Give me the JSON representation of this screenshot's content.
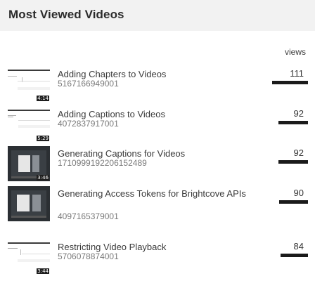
{
  "header": {
    "title": "Most Viewed Videos"
  },
  "columns": {
    "views_label": "views"
  },
  "colors": {
    "bar": "#1a1a1a",
    "header_bg": "#f2f2f2"
  },
  "videos": [
    {
      "name": "Adding Chapters to Videos",
      "id": "5167166949001",
      "duration": "4:14",
      "views": "111",
      "views_value": 111,
      "thumb": "wide-blank"
    },
    {
      "name": "Adding Captions to Videos",
      "id": "4072837917001",
      "duration": "5:29",
      "views": "92",
      "views_value": 92,
      "thumb": "wide-blank"
    },
    {
      "name": "Generating Captions for Videos",
      "id": "1710999192206152489",
      "duration": "3:46",
      "views": "92",
      "views_value": 92,
      "thumb": "dark-ui"
    },
    {
      "name": "Generating Access Tokens for Brightcove APIs",
      "id": "4097165379001",
      "duration": "",
      "views": "90",
      "views_value": 90,
      "thumb": "dark-ui"
    },
    {
      "name": "Restricting Video Playback",
      "id": "5706078874001",
      "duration": "3:44",
      "views": "84",
      "views_value": 84,
      "thumb": "wide-blank"
    }
  ]
}
